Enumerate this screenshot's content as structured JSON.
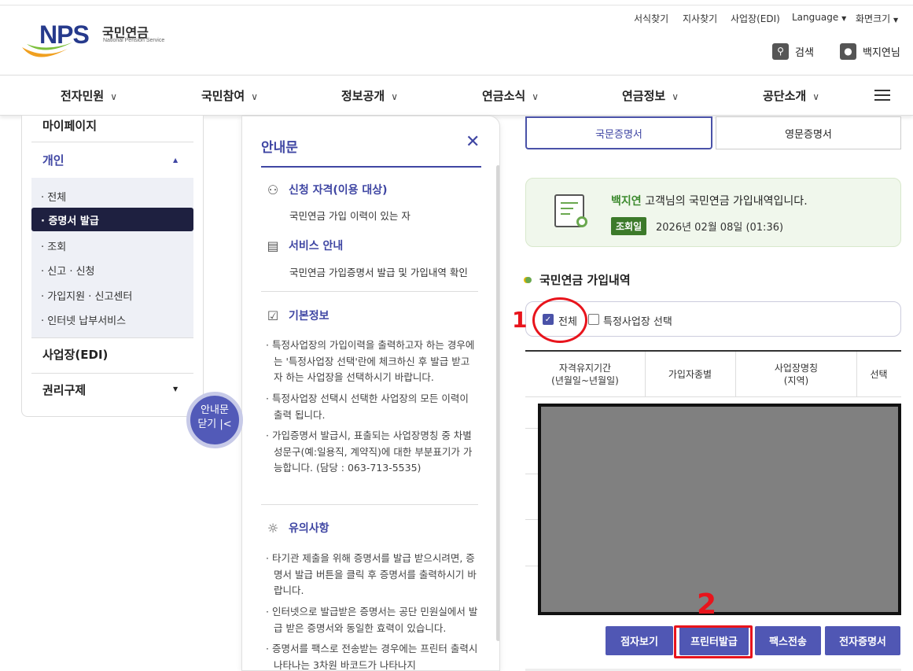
{
  "header": {
    "logo_text": "NPS",
    "logo_korean": "국민연금",
    "logo_english": "National Pension Service",
    "util_links": [
      "서식찾기",
      "지사찾기",
      "사업장(EDI)",
      "Language",
      "화면크기"
    ],
    "search_label": "검색",
    "user_label": "백지연님"
  },
  "gnb": {
    "items": [
      "전자민원",
      "국민참여",
      "정보공개",
      "연금소식",
      "연금정보",
      "공단소개"
    ]
  },
  "sidebar": {
    "mypage": "마이페이지",
    "group": "개인",
    "items": [
      "· 전체",
      "· 증명서 발급",
      "· 조회",
      "· 신고 · 신청",
      "· 가입지원 · 신고센터",
      "· 인터넷 납부서비스"
    ],
    "edi": "사업장(EDI)",
    "rights": "권리구제",
    "close_line1": "안내문",
    "close_line2": "닫기 |<"
  },
  "notice": {
    "title": "안내문",
    "sec1_title": "신청 자격(이용 대상)",
    "sec1_text": "국민연금 가입 이력이 있는 자",
    "sec2_title": "서비스 안내",
    "sec2_text": "국민연금 가입증명서 발급 및 가입내역 확인",
    "sec3_title": "기본정보",
    "sec3_bullets": [
      "· 특정사업장의 가입이력을 출력하고자 하는 경우에는 '특정사업장 선택'란에 체크하신 후 발급 받고자 하는 사업장을 선택하시기 바랍니다.",
      "· 특정사업장 선택시 선택한 사업장의 모든 이력이 출력 됩니다.",
      "· 가입증명서 발급시, 표출되는 사업장명칭 중 차별성문구(예:일용직, 계약직)에 대한 부분표기가 가능합니다. (담당 : 063-713-5535)"
    ],
    "sec4_title": "유의사항",
    "sec4_bullets": [
      "· 타기관 제출을 위해 증명서를 발급 받으시려면, 증명서 발급 버튼을 클릭 후 증명서를 출력하시기 바랍니다.",
      "· 인터넷으로 발급받은 증명서는 공단 민원실에서 발급 받은 증명서와 동일한 효력이 있습니다.",
      "· 증명서를 팩스로 전송받는 경우에는 프린터 출력시 나타나는 3차원 바코드가 나타나지"
    ]
  },
  "content": {
    "tab_korean": "국문증명서",
    "tab_english": "영문증명서",
    "greet_name": "백지연",
    "greet_rest": " 고객님의 국민연금 가입내역입니다.",
    "badge": "조회일",
    "date": "2026년 02월 08일 (01:36)",
    "section_title": "국민연금 가입내역",
    "check_all": "전체",
    "check_specific": "특정사업장 선택",
    "columns": [
      "자격유지기간\n(년월일~년월일)",
      "가입자종별",
      "사업장명칭\n(지역)",
      "선택"
    ],
    "buttons": [
      "점자보기",
      "프린터발급",
      "팩스전송",
      "전자증명서"
    ],
    "annot1": "1",
    "annot2": "2"
  },
  "colors": {
    "brand": "#3f46a3",
    "button": "#5057b4",
    "annotation": "#e8141c"
  }
}
